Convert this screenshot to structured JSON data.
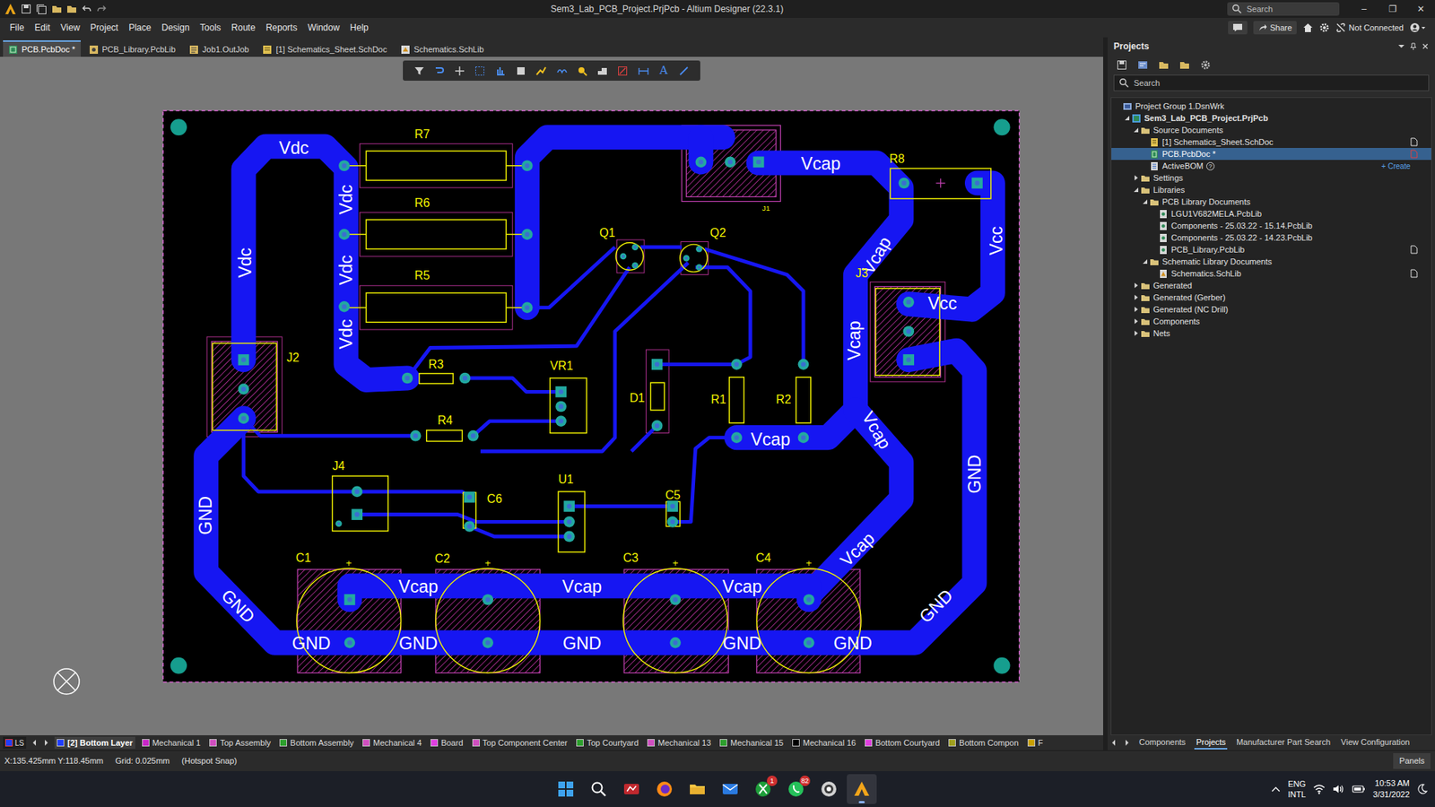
{
  "window": {
    "title": "Sem3_Lab_PCB_Project.PrjPcb - Altium Designer (22.3.1)",
    "search_placeholder": "Search",
    "controls": [
      "–",
      "❐",
      "✕"
    ]
  },
  "menu": [
    "File",
    "Edit",
    "View",
    "Project",
    "Place",
    "Design",
    "Tools",
    "Route",
    "Reports",
    "Window",
    "Help"
  ],
  "account": {
    "share": "Share",
    "status": "Not Connected"
  },
  "doc_tabs": [
    {
      "label": "PCB.PcbDoc *",
      "kind": "pcbdoc",
      "selected": true
    },
    {
      "label": "PCB_Library.PcbLib",
      "kind": "pcblib",
      "selected": false
    },
    {
      "label": "Job1.OutJob",
      "kind": "outjob",
      "selected": false
    },
    {
      "label": "[1] Schematics_Sheet.SchDoc",
      "kind": "schdoc",
      "selected": false
    },
    {
      "label": "Schematics.SchLib",
      "kind": "schlib",
      "selected": false
    }
  ],
  "toolbar": {
    "text_tool": "A"
  },
  "pcb": {
    "designators": [
      "R7",
      "R6",
      "R5",
      "R3",
      "R4",
      "Q1",
      "Q2",
      "VR1",
      "D1",
      "R1",
      "R2",
      "J1",
      "J2",
      "J3",
      "J4",
      "C6",
      "U1",
      "C5",
      "C1",
      "C2",
      "C3",
      "C4",
      "R8"
    ],
    "net_labels": [
      "Vdc",
      "Vdc",
      "Vdc",
      "Vdc",
      "Vdc",
      "Vcap",
      "Vcap",
      "Vcap",
      "Vcap",
      "Vcap",
      "Vcap",
      "Vcap",
      "Vcap",
      "Vcap",
      "Vcc",
      "Vcc",
      "GND",
      "GND",
      "GND",
      "GND",
      "GND",
      "GND",
      "GND",
      "GND",
      "GND"
    ],
    "polarity_marks": [
      "+",
      "+",
      "+",
      "+"
    ]
  },
  "projects_panel": {
    "title": "Projects",
    "search_placeholder": "Search",
    "tree": [
      {
        "label": "Project Group 1.DsnWrk",
        "level": 0,
        "kind": "group",
        "selected": false,
        "mark": "none"
      },
      {
        "label": "Sem3_Lab_PCB_Project.PrjPcb",
        "level": 1,
        "kind": "project",
        "expanded": true,
        "selected": false,
        "mark": "none"
      },
      {
        "label": "Source Documents",
        "level": 2,
        "kind": "folder",
        "expanded": true,
        "selected": false,
        "mark": "none"
      },
      {
        "label": "[1] Schematics_Sheet.SchDoc",
        "level": 3,
        "kind": "schdoc",
        "selected": false,
        "mark": "plain"
      },
      {
        "label": "PCB.PcbDoc *",
        "level": 3,
        "kind": "pcbdoc",
        "selected": true,
        "mark": "modified"
      },
      {
        "label": "ActiveBOM",
        "level": 3,
        "kind": "bom",
        "selected": false,
        "mark": "none",
        "badge": "?",
        "link": "+ Create"
      },
      {
        "label": "Settings",
        "level": 2,
        "kind": "folder",
        "expanded": false,
        "selected": false,
        "mark": "none"
      },
      {
        "label": "Libraries",
        "level": 2,
        "kind": "folder",
        "expanded": true,
        "selected": false,
        "mark": "none"
      },
      {
        "label": "PCB Library Documents",
        "level": 3,
        "kind": "folder",
        "expanded": true,
        "selected": false,
        "mark": "none"
      },
      {
        "label": "LGU1V682MELA.PcbLib",
        "level": 4,
        "kind": "pcblib",
        "selected": false,
        "mark": "none"
      },
      {
        "label": "Components - 25.03.22 - 15.14.PcbLib",
        "level": 4,
        "kind": "pcblib",
        "selected": false,
        "mark": "none"
      },
      {
        "label": "Components - 25.03.22 - 14.23.PcbLib",
        "level": 4,
        "kind": "pcblib",
        "selected": false,
        "mark": "none"
      },
      {
        "label": "PCB_Library.PcbLib",
        "level": 4,
        "kind": "pcblib",
        "selected": false,
        "mark": "plain"
      },
      {
        "label": "Schematic Library Documents",
        "level": 3,
        "kind": "folder",
        "expanded": true,
        "selected": false,
        "mark": "none"
      },
      {
        "label": "Schematics.SchLib",
        "level": 4,
        "kind": "schlib",
        "selected": false,
        "mark": "plain"
      },
      {
        "label": "Generated",
        "level": 2,
        "kind": "folder",
        "expanded": false,
        "selected": false,
        "mark": "none"
      },
      {
        "label": "Generated (Gerber)",
        "level": 2,
        "kind": "folder",
        "expanded": false,
        "selected": false,
        "mark": "none"
      },
      {
        "label": "Generated (NC Drill)",
        "level": 2,
        "kind": "folder",
        "expanded": false,
        "selected": false,
        "mark": "none"
      },
      {
        "label": "Components",
        "level": 2,
        "kind": "folder",
        "expanded": false,
        "selected": false,
        "mark": "none"
      },
      {
        "label": "Nets",
        "level": 2,
        "kind": "folder",
        "expanded": false,
        "selected": false,
        "mark": "none"
      }
    ]
  },
  "panel_tabs": [
    {
      "label": "Components",
      "selected": false
    },
    {
      "label": "Projects",
      "selected": true
    },
    {
      "label": "Manufacturer Part Search",
      "selected": false
    },
    {
      "label": "View Configuration",
      "selected": false
    }
  ],
  "layers": {
    "set": "LS",
    "items": [
      {
        "label": "[2] Bottom Layer",
        "color": "#1f3dff",
        "selected": true
      },
      {
        "label": "Mechanical 1",
        "color": "#c828c8",
        "selected": false
      },
      {
        "label": "Top Assembly",
        "color": "#d050c0",
        "selected": false
      },
      {
        "label": "Bottom Assembly",
        "color": "#2ea02e",
        "selected": false
      },
      {
        "label": "Mechanical 4",
        "color": "#d050c0",
        "selected": false
      },
      {
        "label": "Board",
        "color": "#e040e0",
        "selected": false
      },
      {
        "label": "Top Component Center",
        "color": "#d050c0",
        "selected": false
      },
      {
        "label": "Top Courtyard",
        "color": "#2ea02e",
        "selected": false
      },
      {
        "label": "Mechanical 13",
        "color": "#d050c0",
        "selected": false
      },
      {
        "label": "Mechanical 15",
        "color": "#2ea02e",
        "selected": false
      },
      {
        "label": "Mechanical 16",
        "color": "#000000",
        "selected": false
      },
      {
        "label": "Bottom Courtyard",
        "color": "#e040e0",
        "selected": false
      },
      {
        "label": "Bottom Compon",
        "color": "#a0a020",
        "selected": false
      },
      {
        "label": "F",
        "color": "#c8a000",
        "selected": false
      }
    ]
  },
  "status_bar": {
    "coords": "X:135.425mm Y:118.45mm",
    "grid": "Grid: 0.025mm",
    "snap": "(Hotspot Snap)",
    "panels": "Panels"
  },
  "taskbar": {
    "apps": [
      {
        "kind": "start",
        "selected": false
      },
      {
        "kind": "search",
        "selected": false
      },
      {
        "kind": "red-app",
        "selected": false
      },
      {
        "kind": "firefox",
        "selected": false
      },
      {
        "kind": "explorer",
        "selected": false
      },
      {
        "kind": "mail",
        "selected": false
      },
      {
        "kind": "xbox",
        "selected": false,
        "badge": "1"
      },
      {
        "kind": "whatsapp",
        "selected": false,
        "badge": "82"
      },
      {
        "kind": "chrome",
        "selected": false
      },
      {
        "kind": "altium",
        "selected": true
      }
    ],
    "tray": {
      "lang": "ENG",
      "layout": "INTL",
      "time": "10:53 AM",
      "date": "3/31/2022"
    }
  }
}
